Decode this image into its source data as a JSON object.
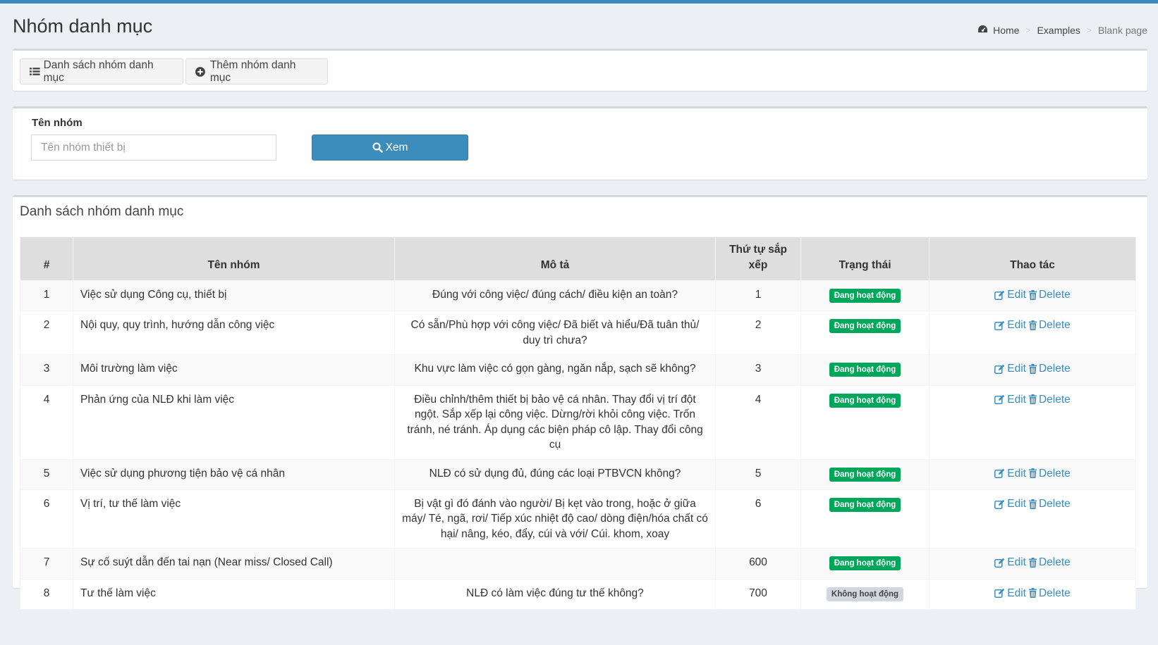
{
  "page": {
    "title": "Nhóm danh mục",
    "breadcrumb": [
      "Home",
      "Examples",
      "Blank page"
    ]
  },
  "toolbar": {
    "list_label": "Danh sách nhóm danh mục",
    "add_label": "Thêm nhóm danh mục"
  },
  "filter": {
    "label": "Tên nhóm",
    "placeholder": "Tên nhóm thiết bị",
    "value": "",
    "button_label": "Xem"
  },
  "list": {
    "title": "Danh sách nhóm danh mục",
    "columns": [
      "#",
      "Tên nhóm",
      "Mô tả",
      "Thứ tự sắp xếp",
      "Trạng thái",
      "Thao tác"
    ],
    "edit_label": "Edit",
    "delete_label": "Delete",
    "rows": [
      {
        "idx": "1",
        "name": "Việc sử dụng Công cụ, thiết bị",
        "desc": "Đúng với công việc/ đúng cách/ điều kiện an toàn?",
        "order": "1",
        "status": "Đang hoạt động",
        "active": true
      },
      {
        "idx": "2",
        "name": "Nội quy, quy trình, hướng dẫn công việc",
        "desc": "Có sẵn/Phù hợp với công việc/ Đã biết và hiểu/Đã tuân thủ/ duy trì chưa?",
        "order": "2",
        "status": "Đang hoạt động",
        "active": true
      },
      {
        "idx": "3",
        "name": "Môi trường làm việc",
        "desc": "Khu vực làm việc có gọn gàng, ngăn nắp, sạch sẽ không?",
        "order": "3",
        "status": "Đang hoạt động",
        "active": true
      },
      {
        "idx": "4",
        "name": "Phản ứng của NLĐ khi làm việc",
        "desc": "Điều chỉnh/thêm thiết bị bảo vệ cá nhân. Thay đổi vị trí đột ngột. Sắp xếp lại công việc. Dừng/rời khỏi công việc. Trốn tránh, né tránh. Áp dụng các biện pháp cô lập. Thay đổi công cụ",
        "order": "4",
        "status": "Đang hoạt động",
        "active": true
      },
      {
        "idx": "5",
        "name": "Việc sử dụng phương tiện bảo vệ cá nhân",
        "desc": "NLĐ có sử dụng đủ, đúng các loại PTBVCN không?",
        "order": "5",
        "status": "Đang hoạt động",
        "active": true
      },
      {
        "idx": "6",
        "name": "Vị trí, tư thế làm việc",
        "desc": "Bị vật gì đó đánh vào người/ Bị kẹt vào trong, hoặc ở giữa máy/ Té, ngã, rơi/ Tiếp xúc nhiệt độ cao/ dòng điện/hóa chất có hại/ nâng, kéo, đẩy, cúi và với/ Cúi. khom, xoay",
        "order": "6",
        "status": "Đang hoạt động",
        "active": true
      },
      {
        "idx": "7",
        "name": "Sự cố suýt dẫn đến tai nạn (Near miss/ Closed Call)",
        "desc": "",
        "order": "600",
        "status": "Đang hoạt động",
        "active": true
      },
      {
        "idx": "8",
        "name": "Tư thế làm việc",
        "desc": "NLĐ có làm việc đúng tư thế không?",
        "order": "700",
        "status": "Không hoạt động",
        "active": false
      }
    ]
  },
  "colors": {
    "primary": "#3c8dbc",
    "success": "#00a65a",
    "inactive": "#d2d6de",
    "background": "#ecf0f5"
  }
}
